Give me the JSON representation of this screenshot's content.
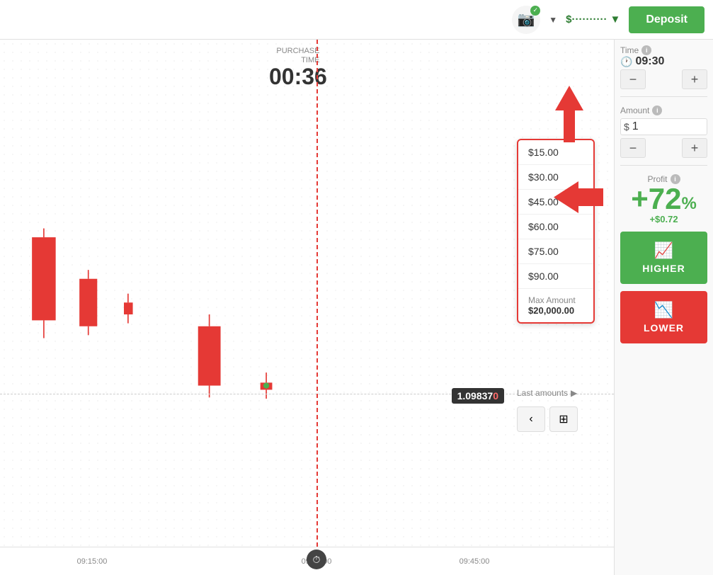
{
  "topbar": {
    "deposit_label": "Deposit",
    "balance_text": "$··········",
    "dropdown_arrow": "▼"
  },
  "chart": {
    "purchase_time_label": "PURCHASE\nTIME",
    "purchase_time_value": "00:36",
    "price_value": "1.09837",
    "price_highlight": "0",
    "time_ticks": [
      "09:15:00",
      "09:30:00",
      "09:45:00"
    ]
  },
  "amount_dropdown": {
    "items": [
      "$15.00",
      "$30.00",
      "$45.00",
      "$60.00",
      "$75.00",
      "$90.00"
    ],
    "max_label": "Max Amount",
    "max_value": "$20,000.00",
    "last_amounts": "Last amounts"
  },
  "sidebar": {
    "time_label": "Time",
    "time_value": "09:30",
    "minus_label": "−",
    "plus_label": "+",
    "amount_label": "Amount",
    "amount_value": "1",
    "dollar_sign": "$",
    "profit_label": "Profit",
    "profit_percent": "+72%",
    "profit_value": "+$0.72",
    "higher_label": "HIGHER",
    "lower_label": "LOWER"
  }
}
